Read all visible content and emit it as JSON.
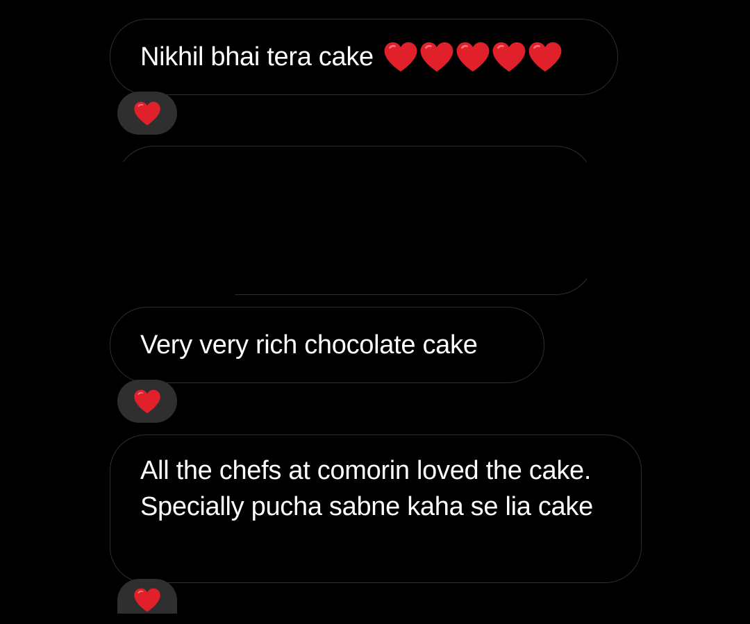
{
  "chat": {
    "messages": [
      {
        "text": "Nikhil bhai tera cake",
        "emoji_count": 5,
        "emoji": "red-heart-icon",
        "reaction": "red-heart-icon"
      },
      {
        "text": "",
        "note": ""
      },
      {
        "text": "Very very rich chocolate cake",
        "reaction": "red-heart-icon"
      },
      {
        "text": "All the chefs at comorin loved the cake. Specially pucha sabne kaha se lia cake",
        "reaction": "red-heart-icon"
      }
    ]
  },
  "colors": {
    "background": "#000000",
    "bubble_border": "#2e2e2e",
    "reaction_pill": "#2f2f2f",
    "heart": "#e0202a",
    "text": "#ffffff"
  }
}
